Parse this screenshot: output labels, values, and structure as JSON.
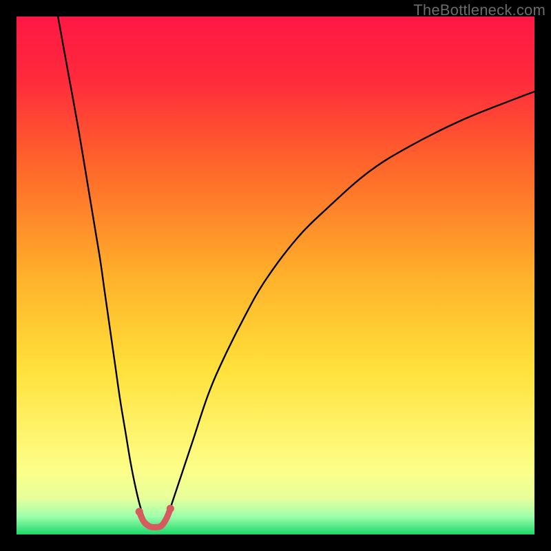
{
  "watermark": "TheBottleneck.com",
  "chart_data": {
    "type": "line",
    "title": "",
    "xlabel": "",
    "ylabel": "",
    "xlim": [
      0,
      100
    ],
    "ylim": [
      0,
      100
    ],
    "grid": false,
    "legend": false,
    "background_gradient": {
      "stops": [
        {
          "offset": 0.0,
          "color": "#ff1744"
        },
        {
          "offset": 0.12,
          "color": "#ff2a3c"
        },
        {
          "offset": 0.3,
          "color": "#ff6a2a"
        },
        {
          "offset": 0.5,
          "color": "#ffb02a"
        },
        {
          "offset": 0.68,
          "color": "#ffe13a"
        },
        {
          "offset": 0.8,
          "color": "#fff36a"
        },
        {
          "offset": 0.88,
          "color": "#fbff8a"
        },
        {
          "offset": 0.93,
          "color": "#e7ff9a"
        },
        {
          "offset": 0.965,
          "color": "#9effac"
        },
        {
          "offset": 1.0,
          "color": "#1cd86a"
        }
      ]
    },
    "series": [
      {
        "name": "curve-left",
        "stroke": "#000000",
        "stroke_width": 2.4,
        "x": [
          8,
          10,
          12,
          14,
          16,
          17,
          18,
          19,
          20,
          21,
          22,
          23,
          24,
          25,
          26
        ],
        "y": [
          100,
          89,
          78,
          66,
          54,
          47,
          40,
          33,
          26,
          20,
          14,
          9,
          5,
          2.5,
          1.5
        ]
      },
      {
        "name": "curve-right",
        "stroke": "#000000",
        "stroke_width": 2.4,
        "x": [
          28,
          29,
          30,
          32,
          34,
          37,
          40,
          44,
          48,
          54,
          60,
          68,
          76,
          86,
          96,
          100
        ],
        "y": [
          1.5,
          3,
          6,
          12,
          18,
          27,
          34,
          42,
          49,
          57,
          63,
          70,
          75,
          80,
          84,
          85.5
        ]
      },
      {
        "name": "marker-cluster",
        "type": "scatter",
        "stroke": "#d65a5e",
        "stroke_width": 9,
        "points": [
          {
            "x": 23.7,
            "y": 4.4
          },
          {
            "x": 24.5,
            "y": 2.6
          },
          {
            "x": 25.6,
            "y": 1.6
          },
          {
            "x": 26.8,
            "y": 1.4
          },
          {
            "x": 28.0,
            "y": 1.7
          },
          {
            "x": 29.0,
            "y": 3.2
          },
          {
            "x": 29.7,
            "y": 5.0
          }
        ]
      }
    ]
  }
}
